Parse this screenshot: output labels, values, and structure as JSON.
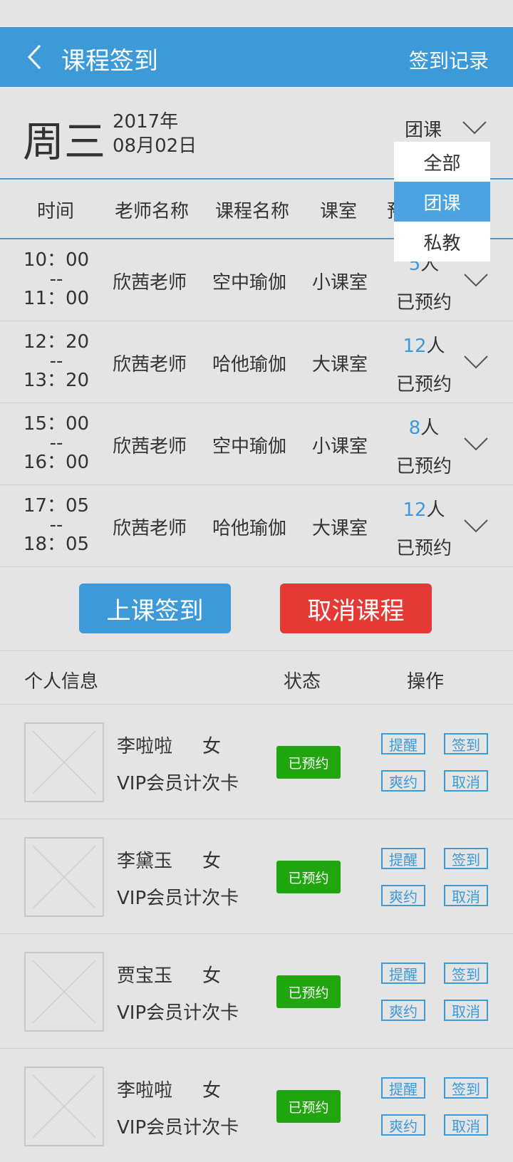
{
  "header": {
    "title": "课程签到",
    "right_link": "签到记录"
  },
  "date": {
    "weekday": "周三",
    "year": "2017年",
    "monthday": "08月02日"
  },
  "filter": {
    "selected": "团课",
    "options": [
      {
        "label": "全部",
        "active": false
      },
      {
        "label": "团课",
        "active": true
      },
      {
        "label": "私教",
        "active": false
      }
    ]
  },
  "table_headers": {
    "time": "时间",
    "teacher": "老师名称",
    "course": "课程名称",
    "room": "课室",
    "booked": "预"
  },
  "courses": [
    {
      "start": "10：00",
      "sep": "--",
      "end": "11：00",
      "teacher": "欣茜老师",
      "course": "空中瑜伽",
      "room": "小课室",
      "count": "5",
      "unit": "人",
      "status": "已预约"
    },
    {
      "start": "12：20",
      "sep": "--",
      "end": "13：20",
      "teacher": "欣茜老师",
      "course": "哈他瑜伽",
      "room": "大课室",
      "count": "12",
      "unit": "人",
      "status": "已预约"
    },
    {
      "start": "15：00",
      "sep": "--",
      "end": "16：00",
      "teacher": "欣茜老师",
      "course": "空中瑜伽",
      "room": "小课室",
      "count": "8",
      "unit": "人",
      "status": "已预约"
    },
    {
      "start": "17：05",
      "sep": "--",
      "end": "18：05",
      "teacher": "欣茜老师",
      "course": "哈他瑜伽",
      "room": "大课室",
      "count": "12",
      "unit": "人",
      "status": "已预约"
    }
  ],
  "actions": {
    "checkin": "上课签到",
    "cancel": "取消课程"
  },
  "member_headers": {
    "info": "个人信息",
    "status": "状态",
    "ops": "操作"
  },
  "members": [
    {
      "name": "李啦啦",
      "gender": "女",
      "card": "VIP会员计次卡",
      "status": "已预约",
      "remind": "提醒",
      "sign": "签到",
      "noshow": "爽约",
      "cancel": "取消"
    },
    {
      "name": "李黛玉",
      "gender": "女",
      "card": "VIP会员计次卡",
      "status": "已预约",
      "remind": "提醒",
      "sign": "签到",
      "noshow": "爽约",
      "cancel": "取消"
    },
    {
      "name": "贾宝玉",
      "gender": "女",
      "card": "VIP会员计次卡",
      "status": "已预约",
      "remind": "提醒",
      "sign": "签到",
      "noshow": "爽约",
      "cancel": "取消"
    },
    {
      "name": "李啦啦",
      "gender": "女",
      "card": "VIP会员计次卡",
      "status": "已预约",
      "remind": "提醒",
      "sign": "签到",
      "noshow": "爽约",
      "cancel": "取消"
    }
  ],
  "colors": {
    "primary": "#3d9ad8",
    "danger": "#e53935",
    "success": "#21a60f",
    "background": "#e4e4e4"
  },
  "icons": {
    "back": "chevron-left-icon",
    "expand": "chevron-down-icon",
    "avatar": "image-placeholder-icon"
  }
}
